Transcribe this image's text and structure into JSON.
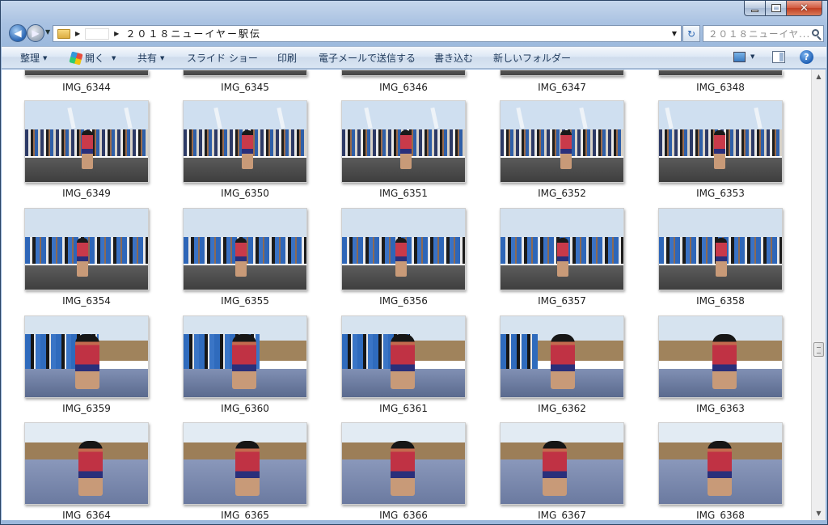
{
  "window": {
    "address": "２０１８ニューイヤー駅伝",
    "search_placeholder": "２０１８ニューイヤ...",
    "caption_minimize": "",
    "caption_maximize": "",
    "caption_close": "✕"
  },
  "toolbar": {
    "organize": "整理",
    "open": "開く",
    "share": "共有",
    "slideshow": "スライド ショー",
    "print": "印刷",
    "email": "電子メールで送信する",
    "burn": "書き込む",
    "new_folder": "新しいフォルダー",
    "help": "?"
  },
  "files": {
    "row0": [
      "IMG_6344",
      "IMG_6345",
      "IMG_6346",
      "IMG_6347",
      "IMG_6348"
    ],
    "row1": [
      "IMG_6349",
      "IMG_6350",
      "IMG_6351",
      "IMG_6352",
      "IMG_6353"
    ],
    "row2": [
      "IMG_6354",
      "IMG_6355",
      "IMG_6356",
      "IMG_6357",
      "IMG_6358"
    ],
    "row3": [
      "IMG_6359",
      "IMG_6360",
      "IMG_6361",
      "IMG_6362",
      "IMG_6363"
    ],
    "row4": [
      "IMG_6364",
      "IMG_6365",
      "IMG_6366",
      "IMG_6367",
      "IMG_6368"
    ]
  },
  "colors": {
    "accent": "#1e395b",
    "sky": "#c9d9ec",
    "road": "#4a4a4a",
    "water": "#7f8db0",
    "field": "#a0835c"
  }
}
